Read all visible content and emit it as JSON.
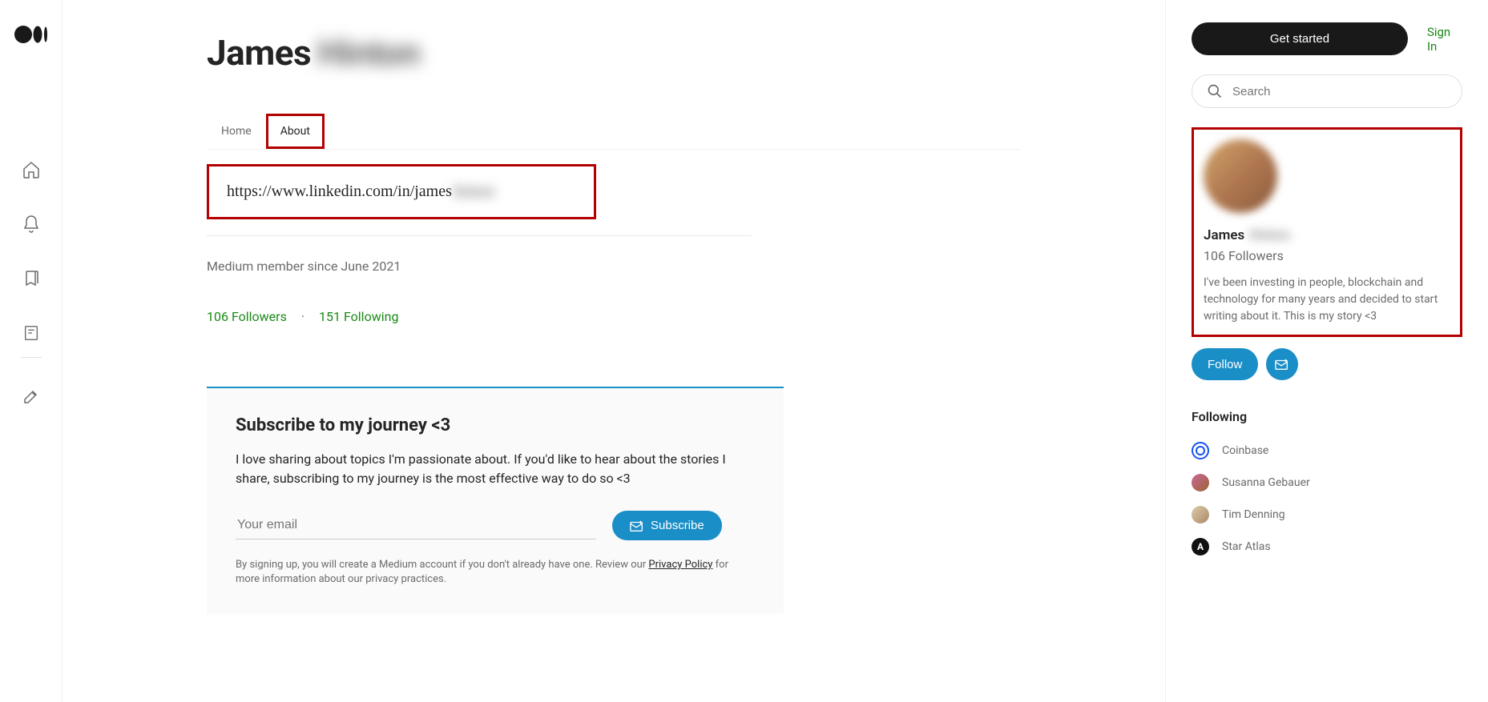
{
  "header": {
    "get_started": "Get started",
    "sign_in": "Sign In",
    "search_placeholder": "Search"
  },
  "profile": {
    "first_name": "James",
    "last_name_obscured": "Hinton",
    "tabs": {
      "home": "Home",
      "about": "About"
    },
    "linkedin_prefix": "https://www.linkedin.com/in/james",
    "linkedin_suffix_obscured": "hinton",
    "member_since": "Medium member since June 2021",
    "followers": "106 Followers",
    "following": "151 Following",
    "stats_separator": "·"
  },
  "subscribe": {
    "title": "Subscribe to my journey <3",
    "description": "I love sharing about topics I'm passionate about. If you'd like to hear about the stories I share, subscribing to my journey is the most effective way to do so <3",
    "email_placeholder": "Your email",
    "button": "Subscribe",
    "fineprint_1": "By signing up, you will create a Medium account if you don't already have one. Review our ",
    "fineprint_link": "Privacy Policy",
    "fineprint_2": " for more information about our privacy practices."
  },
  "sidebar": {
    "name_first": "James",
    "name_last_obscured": "Hinton",
    "followers": "106 Followers",
    "bio": "I've been investing in people, blockchain and technology for many years and decided to start writing about it. This is my story <3",
    "follow_button": "Follow",
    "following_heading": "Following",
    "following_list": [
      {
        "name": "Coinbase",
        "avatar": "coinbase"
      },
      {
        "name": "Susanna Gebauer",
        "avatar": "photo"
      },
      {
        "name": "Tim Denning",
        "avatar": "photo"
      },
      {
        "name": "Star Atlas",
        "avatar": "star"
      }
    ]
  },
  "colors": {
    "accent_teal": "#1a8ec7",
    "annotation_red": "#b40000",
    "link_green": "#1a8917"
  }
}
